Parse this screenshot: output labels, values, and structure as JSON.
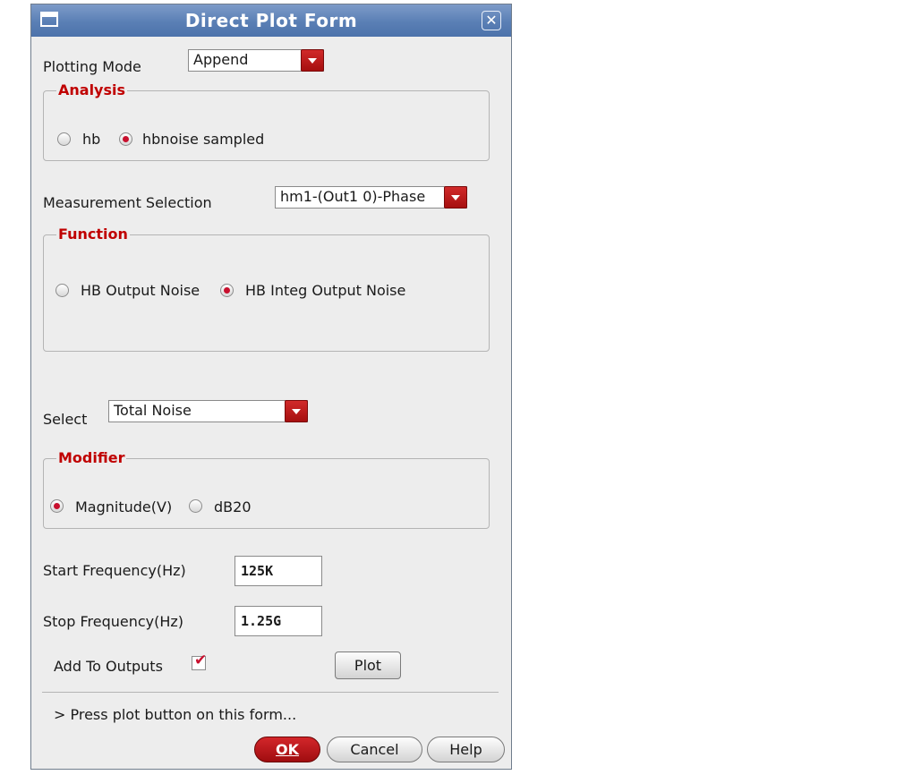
{
  "window": {
    "title": "Direct Plot Form",
    "close_glyph": "✕"
  },
  "plotting_mode": {
    "label": "Plotting Mode",
    "value": "Append"
  },
  "analysis": {
    "title": "Analysis",
    "options": [
      {
        "label": "hb",
        "selected": false
      },
      {
        "label": "hbnoise sampled",
        "selected": true
      }
    ]
  },
  "measurement": {
    "label": "Measurement Selection",
    "value": "hm1-(Out1 0)-Phase"
  },
  "function": {
    "title": "Function",
    "options": [
      {
        "label": "HB Output Noise",
        "selected": false
      },
      {
        "label": "HB Integ Output Noise",
        "selected": true
      }
    ]
  },
  "select": {
    "label": "Select",
    "value": "Total Noise"
  },
  "modifier": {
    "title": "Modifier",
    "options": [
      {
        "label": "Magnitude(V)",
        "selected": true
      },
      {
        "label": "dB20",
        "selected": false
      }
    ]
  },
  "start_frequency": {
    "label": "Start Frequency(Hz)",
    "value": "125K"
  },
  "stop_frequency": {
    "label": "Stop Frequency(Hz)",
    "value": "1.25G"
  },
  "add_to_outputs": {
    "label": "Add To Outputs",
    "checked": true
  },
  "plot_button": {
    "label": "Plot"
  },
  "status_message": "> Press plot button on this form...",
  "buttons": {
    "ok": "OK",
    "cancel": "Cancel",
    "help": "Help"
  },
  "colors": {
    "accent_red": "#c8102e",
    "titlebar_blue": "#5a7fb5",
    "group_title_red": "#c00000"
  }
}
